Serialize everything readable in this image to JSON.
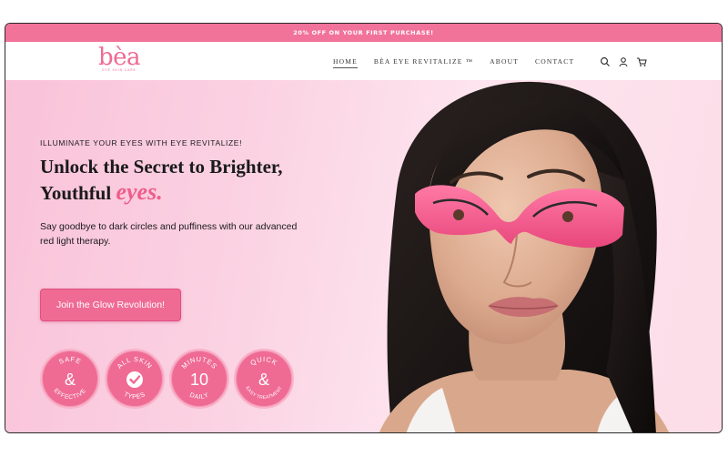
{
  "announcement": {
    "text": "20% OFF ON YOUR FIRST PURCHASE!"
  },
  "brand": {
    "name": "bèa",
    "tagline": "EYE SKIN CARE"
  },
  "nav": {
    "items": [
      {
        "label": "HOME",
        "active": true
      },
      {
        "label": "BÈA EYE REVITALIZE ™",
        "active": false
      },
      {
        "label": "ABOUT",
        "active": false
      },
      {
        "label": "CONTACT",
        "active": false
      }
    ],
    "icons": [
      "search-icon",
      "account-icon",
      "cart-icon"
    ]
  },
  "hero": {
    "eyebrow": "ILLUMINATE YOUR EYES WITH EYE REVITALIZE!",
    "headline_part1": "Unlock the Secret to ",
    "headline_bold1": "Brighter,",
    "headline_bold2": "Youthful ",
    "headline_accent": "eyes.",
    "subtext": "Say goodbye to dark circles and puffiness with our advanced red light therapy.",
    "cta_label": "Join the Glow Revolution!"
  },
  "badges": [
    {
      "top": "SAFE",
      "center": "&",
      "bottom": "EFFECTIVE"
    },
    {
      "top": "ALL SKIN",
      "center": "check-icon",
      "bottom": "TYPES"
    },
    {
      "top": "MINUTES",
      "center": "10",
      "bottom": "DAILY"
    },
    {
      "top": "QUICK",
      "center": "&",
      "bottom": "EASY TREATMENT"
    }
  ],
  "colors": {
    "brand_pink": "#ef6b94",
    "announcement_bg": "#f2739a",
    "hero_bg": "#fbd3e3"
  }
}
